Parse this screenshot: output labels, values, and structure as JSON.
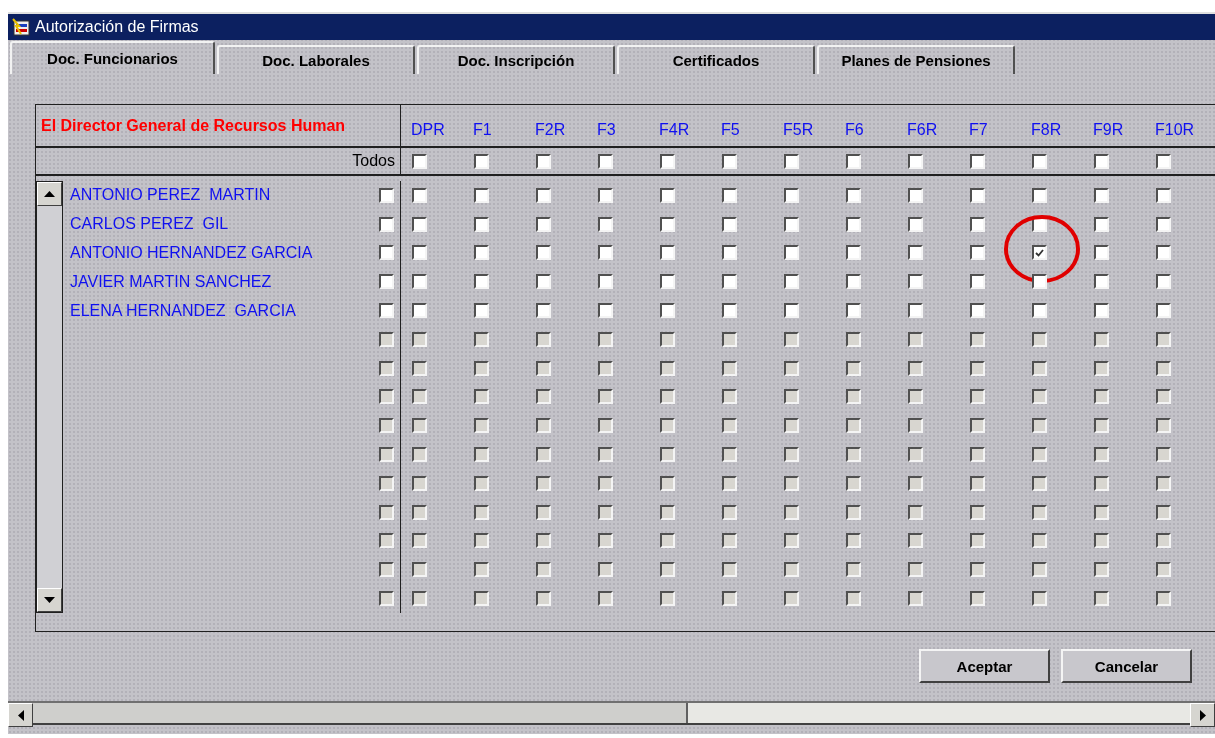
{
  "window": {
    "title": "Autorización de Firmas"
  },
  "tabs": [
    {
      "label": "Doc. Funcionarios",
      "selected": true
    },
    {
      "label": "Doc. Laborales",
      "selected": false
    },
    {
      "label": "Doc. Inscripción",
      "selected": false
    },
    {
      "label": "Certificados",
      "selected": false
    },
    {
      "label": "Planes de Pensiones",
      "selected": false
    }
  ],
  "table": {
    "name_header": "El Director General de Recursos Human",
    "columns": [
      "DPR",
      "F1",
      "F2R",
      "F3",
      "F4R",
      "F5",
      "F5R",
      "F6",
      "F6R",
      "F7",
      "F8R",
      "F9R",
      "F10R"
    ],
    "all_label": "Todos",
    "all_checks": [
      false,
      false,
      false,
      false,
      false,
      false,
      false,
      false,
      false,
      false,
      false,
      false,
      false
    ],
    "rows": [
      {
        "name": "ANTONIO PEREZ  MARTIN",
        "enabled": true,
        "checked": false,
        "cells": [
          false,
          false,
          false,
          false,
          false,
          false,
          false,
          false,
          false,
          false,
          false,
          false,
          false
        ],
        "circled": [
          false,
          false,
          false,
          false,
          false,
          false,
          false,
          false,
          false,
          false,
          false,
          false,
          false
        ]
      },
      {
        "name": "CARLOS PEREZ  GIL",
        "enabled": true,
        "checked": false,
        "cells": [
          false,
          false,
          false,
          false,
          false,
          false,
          false,
          false,
          false,
          false,
          false,
          false,
          false
        ],
        "circled": [
          false,
          false,
          false,
          false,
          false,
          false,
          false,
          false,
          false,
          false,
          false,
          false,
          false
        ]
      },
      {
        "name": "ANTONIO HERNANDEZ GARCIA",
        "enabled": true,
        "checked": false,
        "cells": [
          false,
          false,
          false,
          false,
          false,
          false,
          false,
          false,
          false,
          false,
          true,
          false,
          false
        ],
        "circled": [
          false,
          false,
          false,
          false,
          false,
          false,
          false,
          false,
          false,
          false,
          true,
          false,
          false
        ]
      },
      {
        "name": "JAVIER MARTIN SANCHEZ",
        "enabled": true,
        "checked": false,
        "cells": [
          false,
          false,
          false,
          false,
          false,
          false,
          false,
          false,
          false,
          false,
          false,
          false,
          false
        ],
        "circled": [
          false,
          false,
          false,
          false,
          false,
          false,
          false,
          false,
          false,
          false,
          false,
          false,
          false
        ]
      },
      {
        "name": "ELENA HERNANDEZ  GARCIA",
        "enabled": true,
        "checked": false,
        "cells": [
          false,
          false,
          false,
          false,
          false,
          false,
          false,
          false,
          false,
          false,
          false,
          false,
          false
        ],
        "circled": [
          false,
          false,
          false,
          false,
          false,
          false,
          false,
          false,
          false,
          false,
          false,
          false,
          false
        ]
      },
      {
        "enabled": false,
        "checked": false,
        "cells": [
          false,
          false,
          false,
          false,
          false,
          false,
          false,
          false,
          false,
          false,
          false,
          false,
          false
        ],
        "circled": [
          false,
          false,
          false,
          false,
          false,
          false,
          false,
          false,
          false,
          false,
          false,
          false,
          false
        ]
      },
      {
        "enabled": false,
        "checked": false,
        "cells": [
          false,
          false,
          false,
          false,
          false,
          false,
          false,
          false,
          false,
          false,
          false,
          false,
          false
        ],
        "circled": [
          false,
          false,
          false,
          false,
          false,
          false,
          false,
          false,
          false,
          false,
          false,
          false,
          false
        ]
      },
      {
        "enabled": false,
        "checked": false,
        "cells": [
          false,
          false,
          false,
          false,
          false,
          false,
          false,
          false,
          false,
          false,
          false,
          false,
          false
        ],
        "circled": [
          false,
          false,
          false,
          false,
          false,
          false,
          false,
          false,
          false,
          false,
          false,
          false,
          false
        ]
      },
      {
        "enabled": false,
        "checked": false,
        "cells": [
          false,
          false,
          false,
          false,
          false,
          false,
          false,
          false,
          false,
          false,
          false,
          false,
          false
        ],
        "circled": [
          false,
          false,
          false,
          false,
          false,
          false,
          false,
          false,
          false,
          false,
          false,
          false,
          false
        ]
      },
      {
        "enabled": false,
        "checked": false,
        "cells": [
          false,
          false,
          false,
          false,
          false,
          false,
          false,
          false,
          false,
          false,
          false,
          false,
          false
        ],
        "circled": [
          false,
          false,
          false,
          false,
          false,
          false,
          false,
          false,
          false,
          false,
          false,
          false,
          false
        ]
      },
      {
        "enabled": false,
        "checked": false,
        "cells": [
          false,
          false,
          false,
          false,
          false,
          false,
          false,
          false,
          false,
          false,
          false,
          false,
          false
        ],
        "circled": [
          false,
          false,
          false,
          false,
          false,
          false,
          false,
          false,
          false,
          false,
          false,
          false,
          false
        ]
      },
      {
        "enabled": false,
        "checked": false,
        "cells": [
          false,
          false,
          false,
          false,
          false,
          false,
          false,
          false,
          false,
          false,
          false,
          false,
          false
        ],
        "circled": [
          false,
          false,
          false,
          false,
          false,
          false,
          false,
          false,
          false,
          false,
          false,
          false,
          false
        ]
      },
      {
        "enabled": false,
        "checked": false,
        "cells": [
          false,
          false,
          false,
          false,
          false,
          false,
          false,
          false,
          false,
          false,
          false,
          false,
          false
        ],
        "circled": [
          false,
          false,
          false,
          false,
          false,
          false,
          false,
          false,
          false,
          false,
          false,
          false,
          false
        ]
      },
      {
        "enabled": false,
        "checked": false,
        "cells": [
          false,
          false,
          false,
          false,
          false,
          false,
          false,
          false,
          false,
          false,
          false,
          false,
          false
        ],
        "circled": [
          false,
          false,
          false,
          false,
          false,
          false,
          false,
          false,
          false,
          false,
          false,
          false,
          false
        ]
      },
      {
        "enabled": false,
        "checked": false,
        "cells": [
          false,
          false,
          false,
          false,
          false,
          false,
          false,
          false,
          false,
          false,
          false,
          false,
          false
        ],
        "circled": [
          false,
          false,
          false,
          false,
          false,
          false,
          false,
          false,
          false,
          false,
          false,
          false,
          false
        ]
      }
    ]
  },
  "buttons": [
    "Aceptar",
    "Cancelar"
  ]
}
